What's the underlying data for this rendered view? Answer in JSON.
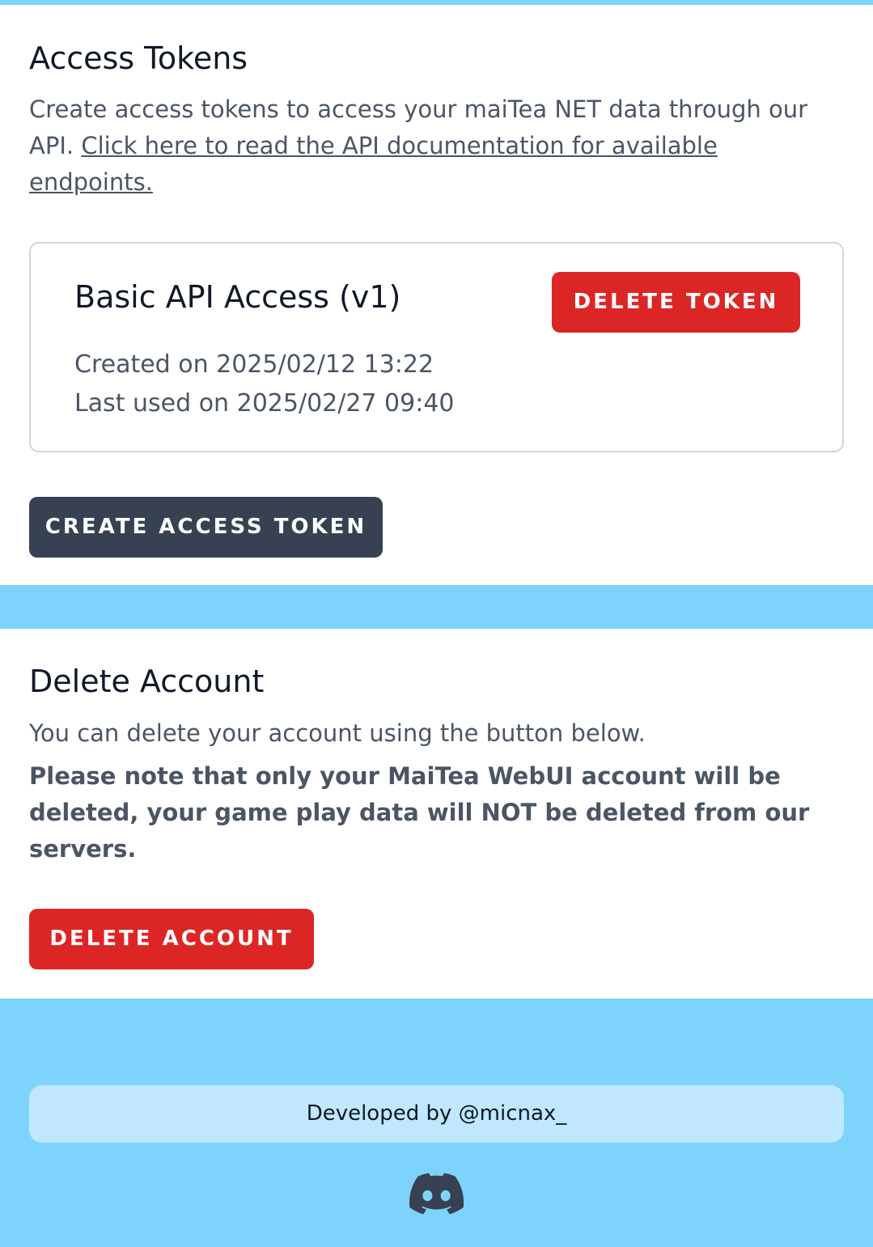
{
  "access_tokens": {
    "title": "Access Tokens",
    "description": "Create access tokens to access your maiTea NET data through our API.",
    "doc_link": "Click here to read the API documentation for available endpoints.",
    "token": {
      "name": "Basic API Access (v1)",
      "created": "Created on 2025/02/12 13:22",
      "last_used": "Last used on 2025/02/27 09:40",
      "delete_label": "DELETE TOKEN"
    },
    "create_label": "CREATE ACCESS TOKEN"
  },
  "delete_account": {
    "title": "Delete Account",
    "description": "You can delete your account using the button below.",
    "note": "Please note that only your MaiTea WebUI account will be deleted, your game play data will NOT be deleted from our servers.",
    "button_label": "DELETE ACCOUNT"
  },
  "footer": {
    "credit": "Developed by @micnax_",
    "icon": "discord-icon"
  },
  "colors": {
    "background": "#7dd3fc",
    "danger": "#dc2626",
    "dark_button": "#374151",
    "footer_pill": "#bfe7fd"
  }
}
